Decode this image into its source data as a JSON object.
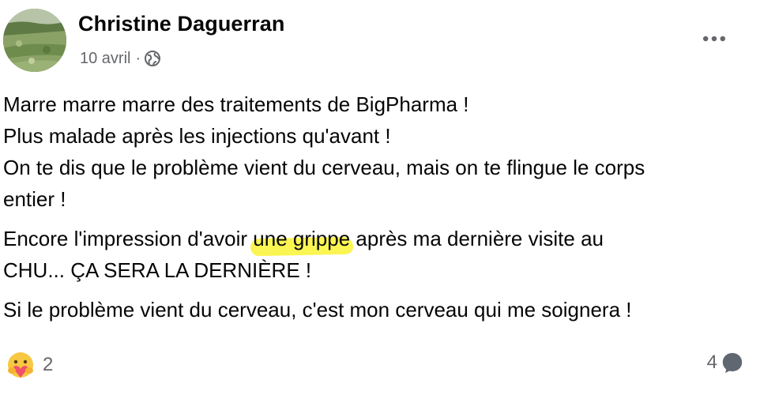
{
  "post": {
    "author": "Christine Daguerran",
    "date": "10 avril",
    "separator": "·",
    "privacy_icon": "globe-icon",
    "more_icon": "more-options-icon",
    "paragraphs": [
      {
        "lines": [
          "Marre marre marre des traitements de BigPharma !",
          "Plus malade après les injections qu'avant !",
          "On te dis que le problème vient du cerveau, mais on te flingue le corps",
          "entier !"
        ]
      },
      {
        "line1_before": "Encore l'impression d'avoir ",
        "line1_highlight": "une grippe",
        "line1_after": " après ma dernière visite au",
        "line2": "CHU... ÇA SERA LA DERNIÈRE !"
      },
      {
        "lines": [
          "Si le problème vient du cerveau, c'est mon cerveau qui me soignera !"
        ]
      }
    ],
    "highlight_color": "#f8f228"
  },
  "footer": {
    "reaction_icon": "care-reaction-icon",
    "reaction_count": "2",
    "comment_count": "4",
    "comment_icon": "comment-bubble-icon"
  }
}
